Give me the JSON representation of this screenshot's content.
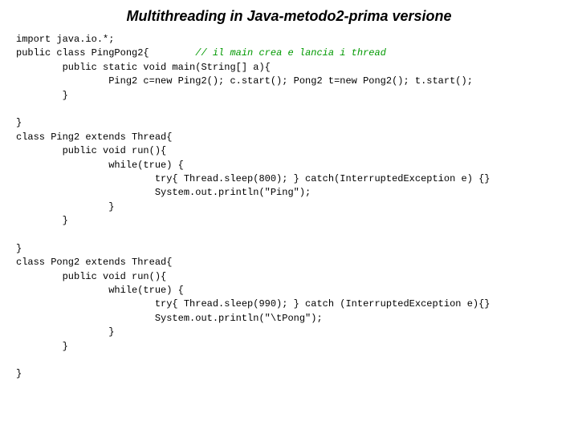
{
  "page": {
    "title": "Multithreading in Java-metodo2-prima versione",
    "code_lines": [
      {
        "id": "line1",
        "text": "import java.io.*;",
        "indent": 0
      },
      {
        "id": "line2",
        "parts": [
          {
            "text": "public class PingPong2{",
            "type": "normal"
          },
          {
            "text": "        // il main crea e lancia i thread",
            "type": "comment"
          }
        ]
      },
      {
        "id": "line3",
        "text": "        public static void main(String[] a){",
        "indent": 0
      },
      {
        "id": "line4",
        "text": "                Ping2 c=new Ping2(); c.start(); Pong2 t=new Pong2(); t.start();",
        "indent": 0
      },
      {
        "id": "line5",
        "text": "        }",
        "indent": 0
      },
      {
        "id": "line6",
        "text": "",
        "indent": 0
      },
      {
        "id": "line7",
        "text": "}",
        "indent": 0
      },
      {
        "id": "line8",
        "text": "class Ping2 extends Thread{",
        "indent": 0
      },
      {
        "id": "line9",
        "text": "        public void run(){",
        "indent": 0
      },
      {
        "id": "line10",
        "text": "                while(true) {",
        "indent": 0
      },
      {
        "id": "line11",
        "text": "                        try{ Thread.sleep(800); } catch(InterruptedException e) {}",
        "indent": 0
      },
      {
        "id": "line12",
        "text": "                        System.out.println(\"Ping\");",
        "indent": 0
      },
      {
        "id": "line13",
        "text": "                }",
        "indent": 0
      },
      {
        "id": "line14",
        "text": "        }",
        "indent": 0
      },
      {
        "id": "line15",
        "text": "",
        "indent": 0
      },
      {
        "id": "line16",
        "text": "}",
        "indent": 0
      },
      {
        "id": "line17",
        "text": "class Pong2 extends Thread{",
        "indent": 0
      },
      {
        "id": "line18",
        "text": "        public void run(){",
        "indent": 0
      },
      {
        "id": "line19",
        "text": "                while(true) {",
        "indent": 0
      },
      {
        "id": "line20",
        "text": "                        try{ Thread.sleep(990); } catch (InterruptedException e){}",
        "indent": 0
      },
      {
        "id": "line21",
        "text": "                        System.out.println(\"\\tPong\");",
        "indent": 0
      },
      {
        "id": "line22",
        "text": "                }",
        "indent": 0
      },
      {
        "id": "line23",
        "text": "        }",
        "indent": 0
      },
      {
        "id": "line24",
        "text": "",
        "indent": 0
      },
      {
        "id": "line25",
        "text": "}",
        "indent": 0
      }
    ],
    "colors": {
      "title": "#000000",
      "background": "#ffffff",
      "code_normal": "#000000",
      "code_comment": "#009900"
    }
  }
}
